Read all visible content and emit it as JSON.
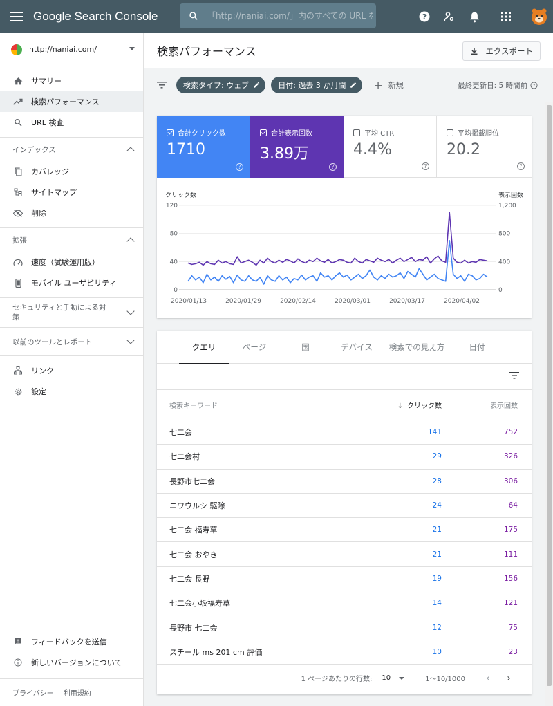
{
  "app": {
    "title": "Google Search Console"
  },
  "search": {
    "placeholder": "「http://naniai.com/」内のすべての URL を検査"
  },
  "property": {
    "url": "http://naniai.com/"
  },
  "sidebar": {
    "main_items": [
      {
        "label": "サマリー",
        "icon": "home-icon"
      },
      {
        "label": "検索パフォーマンス",
        "icon": "trending-up-icon"
      },
      {
        "label": "URL 検査",
        "icon": "search-icon"
      }
    ],
    "index": {
      "title": "インデックス",
      "items": [
        {
          "label": "カバレッジ"
        },
        {
          "label": "サイトマップ"
        },
        {
          "label": "削除"
        }
      ]
    },
    "enhancements": {
      "title": "拡張",
      "items": [
        {
          "label": "速度（試験運用版）"
        },
        {
          "label": "モバイル ユーザビリティ"
        }
      ]
    },
    "security": {
      "title": "セキュリティと手動による対策"
    },
    "legacy": {
      "title": "以前のツールとレポート"
    },
    "other": [
      {
        "label": "リンク"
      },
      {
        "label": "設定"
      }
    ],
    "bottom": [
      {
        "label": "フィードバックを送信"
      },
      {
        "label": "新しいバージョンについて"
      }
    ],
    "footer": {
      "privacy": "プライバシー",
      "terms": "利用規約"
    }
  },
  "header": {
    "title": "検索パフォーマンス",
    "export_label": "エクスポート"
  },
  "filters": {
    "chips": [
      {
        "label": "検索タイプ: ウェブ"
      },
      {
        "label": "日付: 過去 3 か月間"
      }
    ],
    "new_label": "新規",
    "last_updated": "最終更新日: 5 時間前"
  },
  "metrics": [
    {
      "label": "合計クリック数",
      "value": "1710",
      "selected": true,
      "color": "#4285f4"
    },
    {
      "label": "合計表示回数",
      "value": "3.89万",
      "selected": true,
      "color": "#5e35b1"
    },
    {
      "label": "平均 CTR",
      "value": "4.4%",
      "selected": false
    },
    {
      "label": "平均掲載順位",
      "value": "20.2",
      "selected": false
    }
  ],
  "chart_data": {
    "type": "line",
    "ylabel_left": "クリック数",
    "ylabel_right": "表示回数",
    "left_ticks": [
      "120",
      "80",
      "40",
      "0"
    ],
    "right_ticks": [
      "1,200",
      "800",
      "400",
      "0"
    ],
    "ylim_left": [
      0,
      120
    ],
    "ylim_right": [
      0,
      1200
    ],
    "x_ticks": [
      "2020/01/13",
      "2020/01/29",
      "2020/02/14",
      "2020/03/01",
      "2020/03/17",
      "2020/04/02"
    ],
    "grid": true,
    "series": [
      {
        "name": "クリック数",
        "axis": "left",
        "color": "#4285f4",
        "values": [
          12,
          20,
          14,
          18,
          10,
          22,
          14,
          18,
          12,
          20,
          15,
          19,
          10,
          21,
          14,
          12,
          20,
          14,
          12,
          18,
          8,
          20,
          14,
          12,
          20,
          14,
          18,
          10,
          16,
          14,
          21,
          14,
          18,
          20,
          12,
          24,
          18,
          20,
          14,
          20,
          24,
          18,
          21,
          14,
          18,
          22,
          16,
          20,
          28,
          18,
          14,
          20,
          16,
          22,
          18,
          20,
          24,
          16,
          26,
          22,
          18,
          30,
          22,
          14,
          18,
          22,
          16,
          14,
          12,
          70,
          22,
          16,
          20,
          12,
          22,
          20,
          14,
          16,
          22,
          18
        ]
      },
      {
        "name": "表示回数",
        "axis": "right",
        "color": "#5e35b1",
        "values": [
          380,
          360,
          370,
          390,
          350,
          400,
          370,
          360,
          420,
          380,
          400,
          370,
          360,
          470,
          380,
          400,
          420,
          390,
          350,
          420,
          380,
          450,
          400,
          380,
          420,
          390,
          430,
          410,
          380,
          440,
          400,
          380,
          420,
          400,
          450,
          410,
          390,
          430,
          380,
          400,
          430,
          420,
          390,
          380,
          450,
          400,
          380,
          430,
          410,
          390,
          450,
          420,
          400,
          430,
          380,
          420,
          450,
          400,
          430,
          460,
          400,
          430,
          420,
          470,
          380,
          440,
          480,
          410,
          390,
          1100,
          450,
          390,
          380,
          420,
          380,
          400,
          390,
          430,
          420,
          410
        ]
      }
    ]
  },
  "table": {
    "tabs": [
      "クエリ",
      "ページ",
      "国",
      "デバイス",
      "検索での見え方",
      "日付"
    ],
    "columns": {
      "query": "検索キーワード",
      "clicks": "クリック数",
      "impressions": "表示回数"
    },
    "rows": [
      {
        "query": "七二会",
        "clicks": "141",
        "impressions": "752"
      },
      {
        "query": "七二会村",
        "clicks": "29",
        "impressions": "326"
      },
      {
        "query": "長野市七二会",
        "clicks": "28",
        "impressions": "306"
      },
      {
        "query": "ニワウルシ 駆除",
        "clicks": "24",
        "impressions": "64"
      },
      {
        "query": "七二会 福寿草",
        "clicks": "21",
        "impressions": "175"
      },
      {
        "query": "七二会 おやき",
        "clicks": "21",
        "impressions": "111"
      },
      {
        "query": "七二会 長野",
        "clicks": "19",
        "impressions": "156"
      },
      {
        "query": "七二会小坂福寿草",
        "clicks": "14",
        "impressions": "121"
      },
      {
        "query": "長野市 七二会",
        "clicks": "12",
        "impressions": "75"
      },
      {
        "query": "スチール ms 201 cm 評価",
        "clicks": "10",
        "impressions": "23"
      }
    ],
    "pager": {
      "rows_label": "1 ページあたりの行数:",
      "rows_value": "10",
      "range": "1〜10/1000"
    }
  }
}
